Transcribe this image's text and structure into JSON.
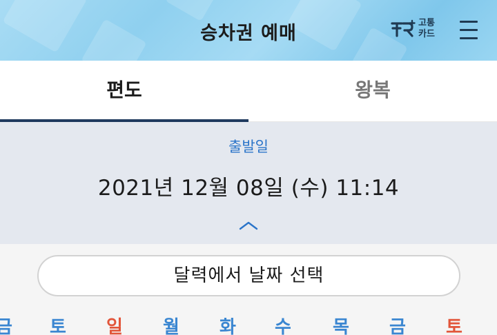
{
  "header": {
    "title": "승차권 예매",
    "brand_text": "고통\n카드",
    "menu_icon": "hamburger-icon",
    "brand_icon": "transport-card-logo"
  },
  "tabs": {
    "oneway_label": "편도",
    "roundtrip_label": "왕복",
    "active": "편도"
  },
  "departure": {
    "label": "출발일",
    "datetime": "2021년 12월 08일 (수) 11:14",
    "collapse_icon": "chevron-up-icon"
  },
  "calendar": {
    "select_button_label": "달력에서 날짜 선택",
    "weekdays": [
      {
        "label": "금",
        "color": "#3a86d1"
      },
      {
        "label": "토",
        "color": "#3a86d1"
      },
      {
        "label": "일",
        "color": "#e2553a"
      },
      {
        "label": "월",
        "color": "#3a86d1"
      },
      {
        "label": "화",
        "color": "#3a86d1"
      },
      {
        "label": "수",
        "color": "#3a86d1"
      },
      {
        "label": "목",
        "color": "#3a86d1"
      },
      {
        "label": "금",
        "color": "#3a86d1"
      },
      {
        "label": "토",
        "color": "#e2553a"
      }
    ]
  },
  "colors": {
    "accent_blue": "#2a74c9",
    "tab_underline": "#1f3a5e",
    "sunday_red": "#e2553a"
  }
}
